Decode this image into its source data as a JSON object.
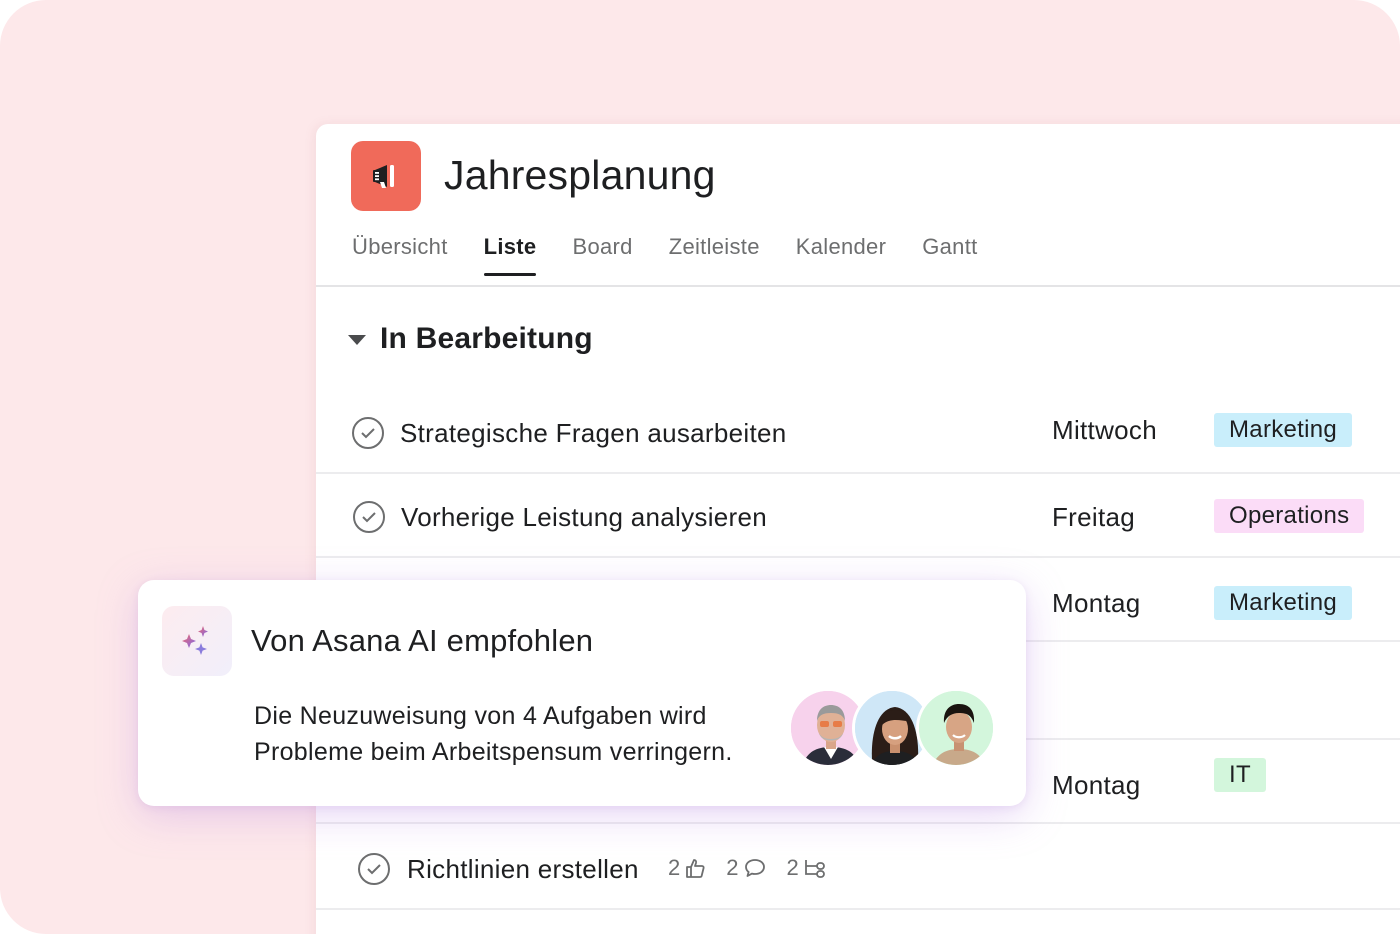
{
  "project": {
    "title": "Jahresplanung",
    "icon": "megaphone-icon",
    "icon_color": "#f06a5a"
  },
  "tabs": [
    {
      "label": "Übersicht",
      "active": false
    },
    {
      "label": "Liste",
      "active": true
    },
    {
      "label": "Board",
      "active": false
    },
    {
      "label": "Zeitleiste",
      "active": false
    },
    {
      "label": "Kalender",
      "active": false
    },
    {
      "label": "Gantt",
      "active": false
    }
  ],
  "section": {
    "title": "In Bearbeitung"
  },
  "tasks": [
    {
      "name": "Strategische Fragen ausarbeiten",
      "due": "Mittwoch",
      "tag": "Marketing",
      "tag_color": "#c9eefb"
    },
    {
      "name": "Vorherige Leistung analysieren",
      "due": "Freitag",
      "tag": "Operations",
      "tag_color": "#fbdcf7"
    },
    {
      "name": "",
      "due": "Montag",
      "tag": "Marketing",
      "tag_color": "#c9eefb"
    },
    {
      "name": "",
      "due": "",
      "tag": "",
      "tag_color": ""
    },
    {
      "name": "",
      "due": "Montag",
      "tag": "IT",
      "tag_color": "#d3f6dc"
    },
    {
      "name": "Richtlinien erstellen",
      "due": "",
      "tag": ""
    }
  ],
  "last_task_meta": {
    "likes": "2",
    "comments": "2",
    "subtasks": "2"
  },
  "ai_card": {
    "title": "Von Asana AI empfohlen",
    "text": "Die Neuzuweisung von 4 Aufgaben wird Probleme beim Arbeitspensum verringern.",
    "icon": "sparkle-icon",
    "avatar_count": 3
  },
  "colors": {
    "background": "#fde8ea",
    "accent": "#f06a5a"
  }
}
